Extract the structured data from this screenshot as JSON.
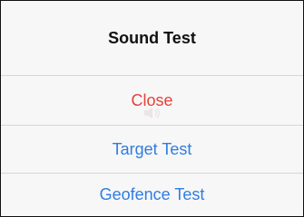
{
  "sheet": {
    "title": "Sound Test",
    "actions": [
      {
        "label": "Close",
        "style": "destructive"
      },
      {
        "label": "Target Test",
        "style": "default"
      },
      {
        "label": "Geofence Test",
        "style": "default"
      }
    ]
  },
  "colors": {
    "title": "#111111",
    "destructive": "#e5413a",
    "action": "#2f7de1",
    "background": "#f7f7f7",
    "divider": "#d6d6da"
  },
  "overlay": {
    "icon": "ghost-speaker-icon"
  }
}
